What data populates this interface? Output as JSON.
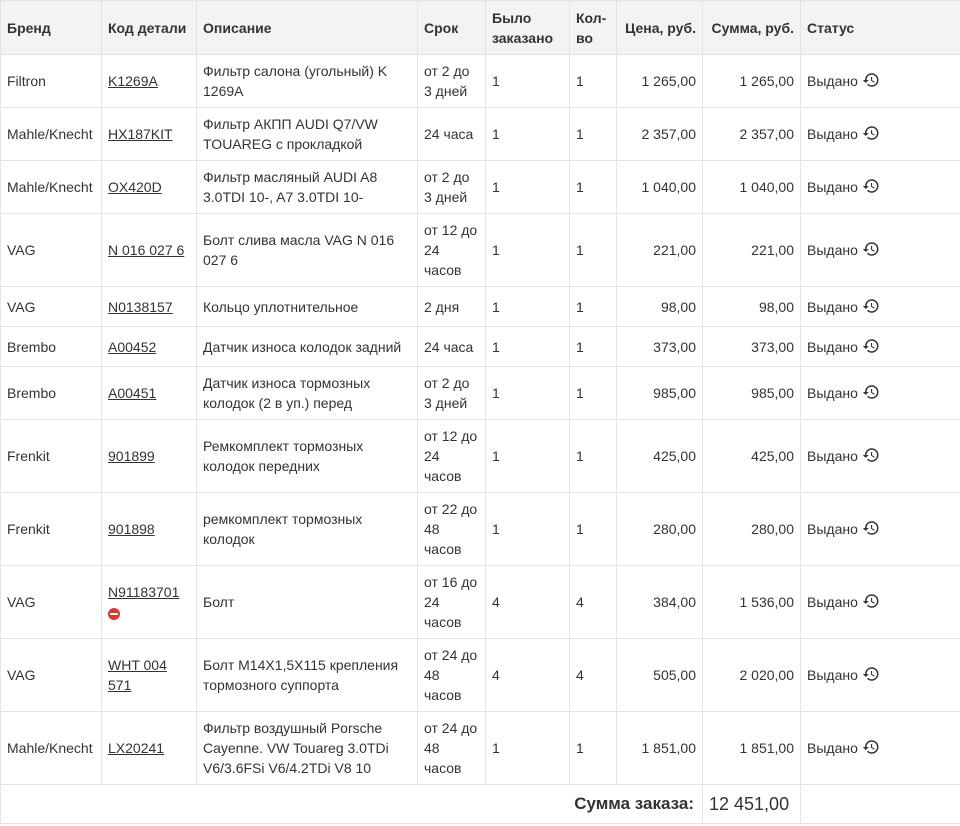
{
  "table": {
    "headers": {
      "brand": "Бренд",
      "code": "Код детали",
      "description": "Описание",
      "term": "Срок",
      "ordered": "Было заказано",
      "qty": "Кол-во",
      "price": "Цена, руб.",
      "sum": "Сумма, руб.",
      "status": "Статус"
    },
    "rows": [
      {
        "brand": "Filtron",
        "code": "K1269A",
        "description": "Фильтр салона (угольный) K 1269A",
        "term": "от 2 до 3 дней",
        "ordered": "1",
        "qty": "1",
        "price": "1 265,00",
        "sum": "1 265,00",
        "status": "Выдано",
        "warning": false
      },
      {
        "brand": "Mahle/Knecht",
        "code": "HX187KIT",
        "description": "Фильтр АКПП AUDI Q7/VW TOUAREG с прокладкой",
        "term": "24 часа",
        "ordered": "1",
        "qty": "1",
        "price": "2 357,00",
        "sum": "2 357,00",
        "status": "Выдано",
        "warning": false
      },
      {
        "brand": "Mahle/Knecht",
        "code": "OX420D",
        "description": "Фильтр масляный AUDI A8 3.0TDI 10-, A7 3.0TDI 10-",
        "term": "от 2 до 3 дней",
        "ordered": "1",
        "qty": "1",
        "price": "1 040,00",
        "sum": "1 040,00",
        "status": "Выдано",
        "warning": false
      },
      {
        "brand": "VAG",
        "code": "N 016 027 6",
        "description": "Болт слива масла VAG N 016 027 6",
        "term": "от 12 до 24 часов",
        "ordered": "1",
        "qty": "1",
        "price": "221,00",
        "sum": "221,00",
        "status": "Выдано",
        "warning": false
      },
      {
        "brand": "VAG",
        "code": "N0138157",
        "description": "Кольцо уплотнительное",
        "term": "2 дня",
        "ordered": "1",
        "qty": "1",
        "price": "98,00",
        "sum": "98,00",
        "status": "Выдано",
        "warning": false
      },
      {
        "brand": "Brembo",
        "code": "A00452",
        "description": "Датчик износа колодок задний",
        "term": "24 часа",
        "ordered": "1",
        "qty": "1",
        "price": "373,00",
        "sum": "373,00",
        "status": "Выдано",
        "warning": false
      },
      {
        "brand": "Brembo",
        "code": "A00451",
        "description": "Датчик износа тормозных колодок (2 в уп.) перед",
        "term": "от 2 до 3 дней",
        "ordered": "1",
        "qty": "1",
        "price": "985,00",
        "sum": "985,00",
        "status": "Выдано",
        "warning": false
      },
      {
        "brand": "Frenkit",
        "code": "901899",
        "description": "Ремкомплект тормозных колодок передних",
        "term": "от 12 до 24 часов",
        "ordered": "1",
        "qty": "1",
        "price": "425,00",
        "sum": "425,00",
        "status": "Выдано",
        "warning": false
      },
      {
        "brand": "Frenkit",
        "code": "901898",
        "description": "ремкомплект тормозных колодок",
        "term": "от 22 до 48 часов",
        "ordered": "1",
        "qty": "1",
        "price": "280,00",
        "sum": "280,00",
        "status": "Выдано",
        "warning": false
      },
      {
        "brand": "VAG",
        "code": "N91183701",
        "description": "Болт",
        "term": "от 16 до 24 часов",
        "ordered": "4",
        "qty": "4",
        "price": "384,00",
        "sum": "1 536,00",
        "status": "Выдано",
        "warning": true
      },
      {
        "brand": "VAG",
        "code": "WHT 004 571",
        "description": "Болт M14X1,5X115 крепления тормозного суппорта",
        "term": "от 24 до 48 часов",
        "ordered": "4",
        "qty": "4",
        "price": "505,00",
        "sum": "2 020,00",
        "status": "Выдано",
        "warning": false
      },
      {
        "brand": "Mahle/Knecht",
        "code": "LX20241",
        "description": "Фильтр воздушный Porsche Cayenne. VW Touareg 3.0TDi V6/3.6FSi V6/4.2TDi V8 10",
        "term": "от 24 до 48 часов",
        "ordered": "1",
        "qty": "1",
        "price": "1 851,00",
        "sum": "1 851,00",
        "status": "Выдано",
        "warning": false
      }
    ]
  },
  "total": {
    "label": "Сумма заказа:",
    "value": "12 451,00"
  },
  "icons": {
    "history": "history-icon",
    "warning": "no-entry-icon"
  },
  "colors": {
    "header_bg": "#f3f3f3",
    "border": "#e4e4e4",
    "warning": "#d9392f",
    "text": "#333333"
  }
}
